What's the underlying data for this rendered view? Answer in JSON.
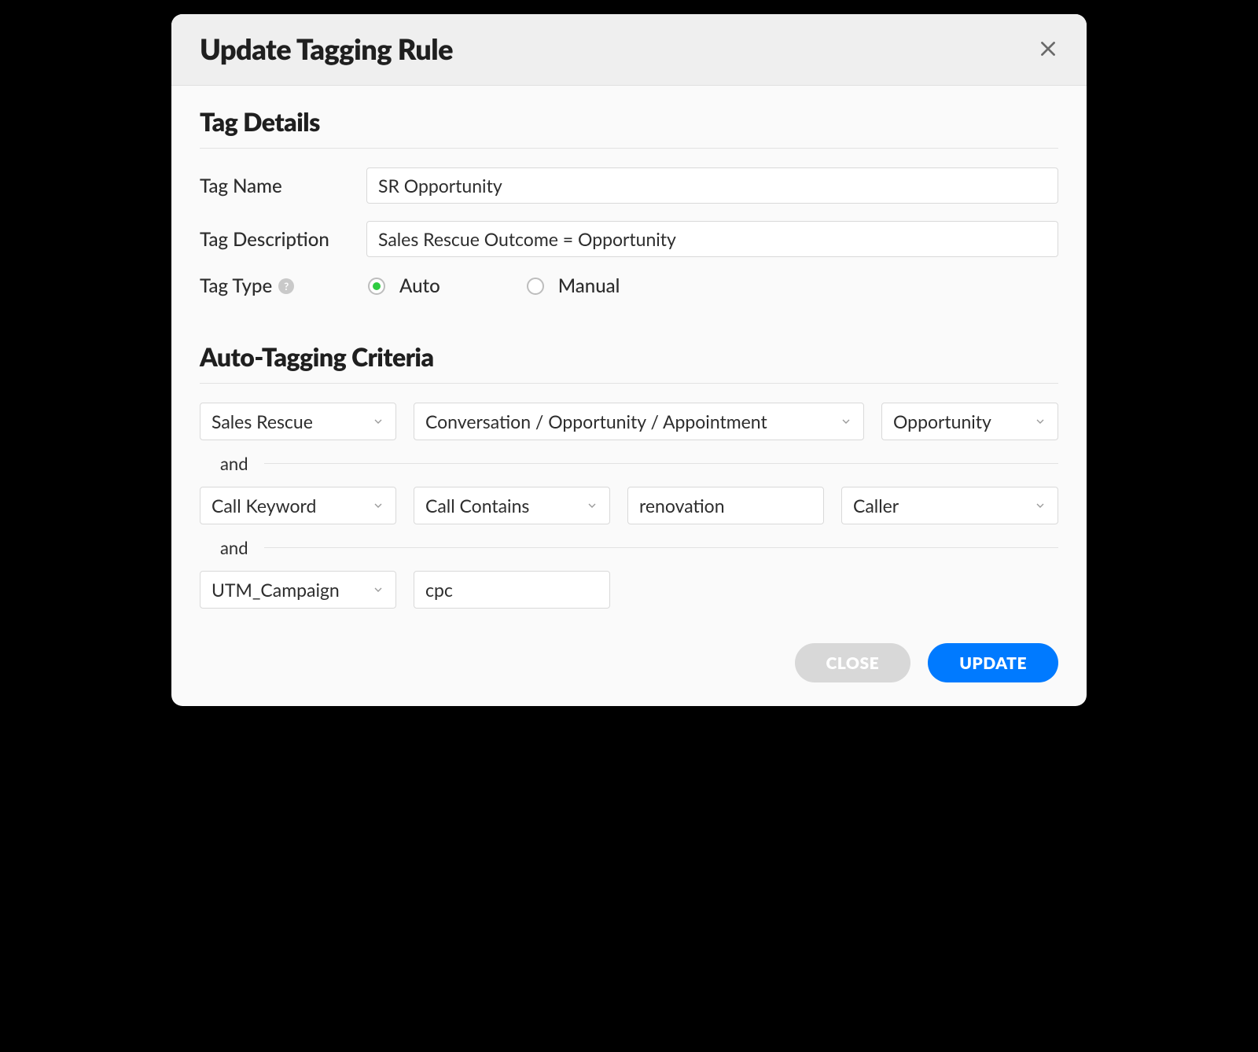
{
  "modal": {
    "title": "Update Tagging Rule"
  },
  "tagDetails": {
    "section_title": "Tag Details",
    "name_label": "Tag Name",
    "name_value": "SR Opportunity",
    "desc_label": "Tag Description",
    "desc_value": "Sales Rescue Outcome = Opportunity",
    "type_label": "Tag Type",
    "type_options": {
      "auto": "Auto",
      "manual": "Manual"
    },
    "type_selected": "auto"
  },
  "criteria": {
    "section_title": "Auto-Tagging Criteria",
    "connector": "and",
    "rules": [
      {
        "col1": "Sales Rescue",
        "col2": "Conversation / Opportunity / Appointment",
        "col3": "Opportunity"
      },
      {
        "col1": "Call Keyword",
        "col2": "Call Contains",
        "col3": "renovation",
        "col4": "Caller"
      },
      {
        "col1": "UTM_Campaign",
        "col2": "cpc"
      }
    ]
  },
  "footer": {
    "close_label": "CLOSE",
    "update_label": "UPDATE"
  }
}
